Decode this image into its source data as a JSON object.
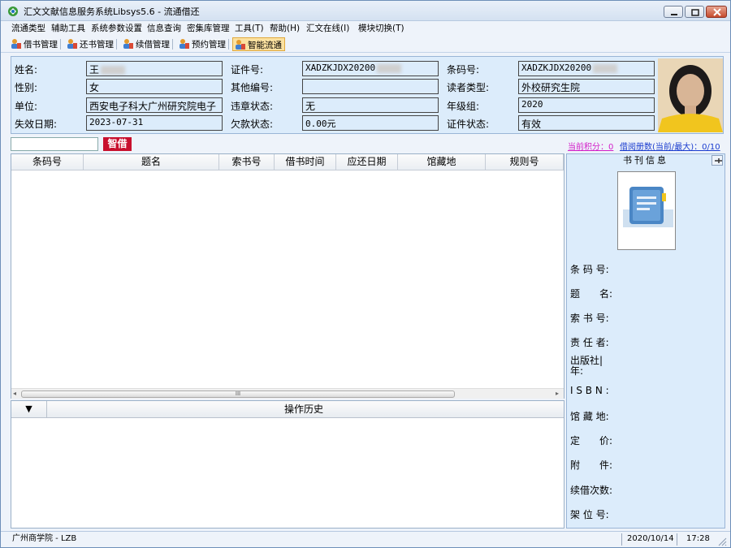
{
  "window": {
    "title": "汇文文献信息服务系统Libsys5.6 - 流通借还"
  },
  "menu": [
    "流通类型",
    "辅助工具",
    "系统参数设置",
    "信息查询",
    "密集库管理",
    "工具(T)",
    "帮助(H)",
    "汇文在线(I)",
    "模块切换(T)"
  ],
  "toolbar": {
    "items": [
      "借书管理",
      "还书管理",
      "续借管理",
      "预约管理",
      "智能流通"
    ],
    "active_index": 4
  },
  "reader": {
    "labels": {
      "name": "姓名:",
      "id_no": "证件号:",
      "barcode": "条码号:",
      "gender": "性别:",
      "other_no": "其他编号:",
      "reader_type": "读者类型:",
      "unit": "单位:",
      "violation": "违章状态:",
      "grade": "年级组:",
      "expire": "失效日期:",
      "debt": "欠款状态:",
      "cert_status": "证件状态:"
    },
    "values": {
      "name": "王",
      "id_no": "XADZKJDX20200",
      "barcode": "XADZKJDX20200",
      "gender": "女",
      "other_no": "",
      "reader_type": "外校研究生院",
      "unit": "西安电子科大广州研究院电子",
      "violation": "无",
      "grade": "2020",
      "expire": "2023-07-31",
      "debt": "0.00元",
      "cert_status": "有效"
    }
  },
  "borrow": {
    "input_value": "",
    "button": "智借",
    "points": "当前积分：0",
    "count": "借阅册数(当前/最大)：0/10"
  },
  "table": {
    "columns": [
      "条码号",
      "题名",
      "索书号",
      "借书时间",
      "应还日期",
      "馆藏地",
      "规则号"
    ],
    "rows": [],
    "scroll_grip": "III"
  },
  "history": {
    "toggle": "▼",
    "title": "操作历史"
  },
  "book_info": {
    "header": "书刊信息",
    "fields": [
      "条 码 号:",
      "题　　名:",
      "索 书 号:",
      "责 任 者:",
      "出版社|年:",
      "I S B N :",
      "馆 藏 地:",
      "定　　价:",
      "附　　件:",
      "续借次数:",
      "架 位 号:"
    ]
  },
  "status": {
    "library": "广州商学院 - LZB",
    "date": "2020/10/14",
    "time": "17:28"
  },
  "colors": {
    "panel_bg": "#dcecfb",
    "smart_button": "#c8102e",
    "points_link": "#d21ec8",
    "count_link": "#1a3ccf"
  }
}
